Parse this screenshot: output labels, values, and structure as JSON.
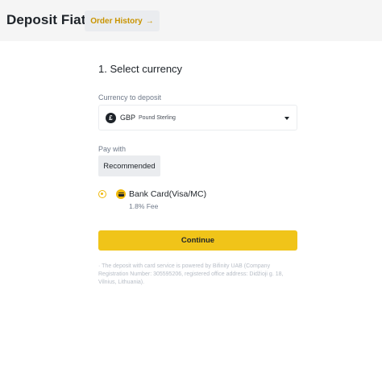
{
  "header": {
    "title": "Deposit Fiat",
    "order_history_label": "Order History",
    "order_history_arrow": "→"
  },
  "form": {
    "step_title": "1. Select currency",
    "currency_label": "Currency to deposit",
    "currency": {
      "icon_symbol": "£",
      "code": "GBP",
      "name": "Pound Sterling",
      "icon": "pound-coin-icon"
    },
    "pay_with_label": "Pay with",
    "tabs": [
      {
        "label": "Recommended",
        "selected": true
      }
    ],
    "payment_methods": [
      {
        "name": "Bank Card(Visa/MC)",
        "fee": "1.8% Fee",
        "selected": true,
        "icon": "bank-card-icon"
      }
    ],
    "continue_label": "Continue",
    "disclaimer": "· The deposit with card service is powered by Bifinity UAB (Company Registration Number: 305595206, registered office address: Didžioji g. 18, Vilnius, Lithuania)."
  },
  "colors": {
    "accent": "#f0b90b",
    "button": "#f0c419",
    "link": "#c99400",
    "header_bg": "#f5f5f5"
  }
}
